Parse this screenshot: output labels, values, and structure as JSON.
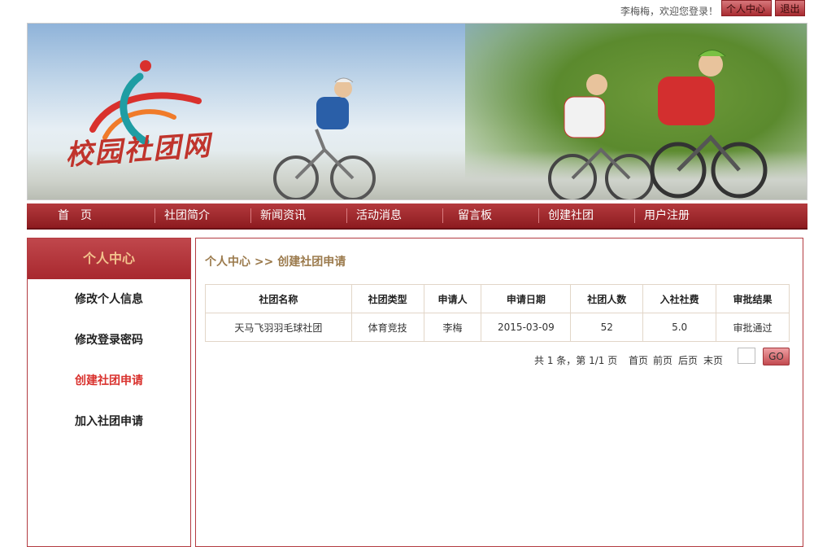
{
  "topbar": {
    "welcome": "李梅梅，欢迎您登录！",
    "center_label": "个人中心",
    "logout_label": "退出"
  },
  "banner": {
    "logo_text": "校园社团网"
  },
  "nav": {
    "items": [
      "首　页",
      "社团简介",
      "新闻资讯",
      "活动消息",
      "留言板",
      "创建社团",
      "用户注册"
    ]
  },
  "sidebar": {
    "title": "个人中心",
    "items": [
      "修改个人信息",
      "修改登录密码",
      "创建社团申请",
      "加入社团申请"
    ],
    "active_index": 2
  },
  "main": {
    "breadcrumb_home": "个人中心",
    "breadcrumb_sep": ">>",
    "breadcrumb_current": "创建社团申请",
    "table": {
      "headers": [
        "社团名称",
        "社团类型",
        "申请人",
        "申请日期",
        "社团人数",
        "入社社费",
        "审批结果"
      ],
      "rows": [
        [
          "天马飞羽羽毛球社团",
          "体育竞技",
          "李梅",
          "2015-03-09",
          "52",
          "5.0",
          "审批通过"
        ]
      ]
    },
    "pager": {
      "info": "共 1 条，第 1/1 页",
      "first": "首页",
      "prev": "前页",
      "next": "后页",
      "last": "末页",
      "go_label": "GO"
    }
  },
  "colors": {
    "brand_red": "#a8282e",
    "breadcrumb": "#9b7a4c",
    "active_link": "#d9312d",
    "sidebar_title": "#f3c38d"
  }
}
